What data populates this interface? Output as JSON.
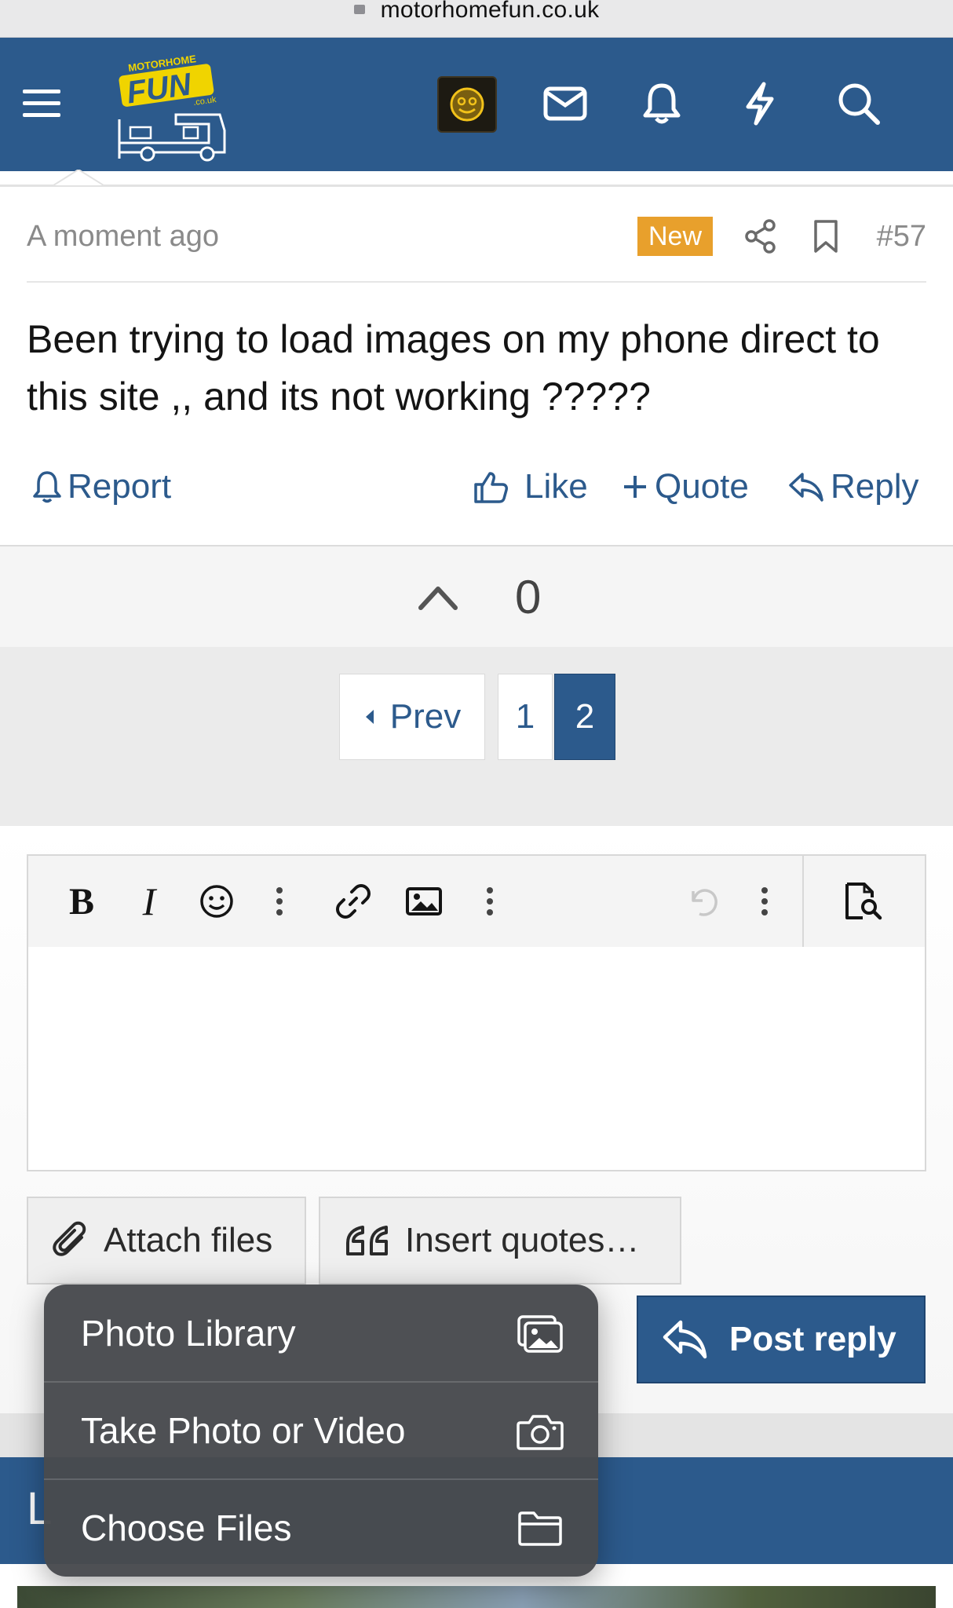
{
  "browser": {
    "url": "motorhomefun.co.uk"
  },
  "header": {
    "logo_text": "FUN",
    "logo_top_text": "MOTORHOME",
    "logo_sub_text": ".co.uk",
    "icons": [
      "menu-icon",
      "avatar",
      "envelope-icon",
      "bell-icon",
      "bolt-icon",
      "search-icon"
    ]
  },
  "post": {
    "time": "A moment ago",
    "badge": "New",
    "number": "#57",
    "message": "Been trying to load images on my phone direct to this site ,, and its not working ?????",
    "actions": {
      "report": "Report",
      "like": "Like",
      "quote": "Quote",
      "reply": "Reply"
    },
    "vote_count": "0"
  },
  "pagination": {
    "prev": "Prev",
    "pages": [
      "1",
      "2"
    ],
    "current": "2"
  },
  "editor": {
    "toolbar_icons": [
      "bold-icon",
      "italic-icon",
      "smiley-icon",
      "more-vertical-icon",
      "link-icon",
      "image-icon",
      "more-vertical-icon",
      "undo-icon",
      "more-vertical-icon",
      "preview-icon"
    ],
    "bold_glyph": "B",
    "italic_glyph": "I"
  },
  "buttons": {
    "attach": "Attach files",
    "insert_quotes": "Insert quotes…",
    "post_reply": "Post reply"
  },
  "popup_menu": {
    "items": [
      {
        "label": "Photo Library",
        "icon": "photo-library-icon"
      },
      {
        "label": "Take Photo or Video",
        "icon": "camera-icon"
      },
      {
        "label": "Choose Files",
        "icon": "folder-icon"
      }
    ]
  },
  "footer": {
    "heading_initial": "L"
  },
  "colors": {
    "brand": "#2c5a8c",
    "badge": "#e8a02c",
    "popup": "#484a4e"
  }
}
